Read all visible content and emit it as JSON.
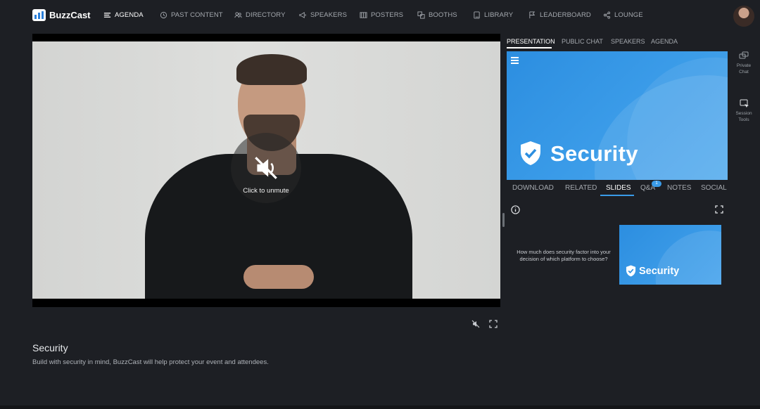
{
  "app": {
    "name": "BuzzCast"
  },
  "nav": {
    "items": [
      {
        "label": "AGENDA",
        "icon": "menu-lines-icon",
        "active": true
      },
      {
        "label": "PAST CONTENT",
        "icon": "history-icon"
      },
      {
        "label": "DIRECTORY",
        "icon": "people-icon"
      },
      {
        "label": "SPEAKERS",
        "icon": "megaphone-icon"
      },
      {
        "label": "POSTERS",
        "icon": "poster-icon"
      },
      {
        "label": "BOOTHS",
        "icon": "booths-icon"
      },
      {
        "label": "LIBRARY",
        "icon": "book-icon"
      },
      {
        "label": "LEADERBOARD",
        "icon": "leaderboard-icon"
      },
      {
        "label": "LOUNGE",
        "icon": "share-icon"
      }
    ]
  },
  "video": {
    "unmute_label": "Click to unmute",
    "muted": true
  },
  "session": {
    "title": "Security",
    "description": "Build with security in mind, BuzzCast will help protect your event and attendees."
  },
  "right_panel": {
    "tabs": [
      "PRESENTATION",
      "PUBLIC CHAT",
      "SPEAKERS",
      "AGENDA"
    ],
    "active_tab": "PRESENTATION",
    "slide_title": "Security",
    "sub_tabs": [
      "DOWNLOAD",
      "RELATED",
      "SLIDES",
      "Q&A",
      "NOTES",
      "SOCIAL"
    ],
    "active_sub_tab": "SLIDES",
    "qa_badge": "1",
    "slides": [
      {
        "question": "How much does security factor into your decision of which platform to choose?",
        "thumb_title": "Security"
      }
    ]
  },
  "rail": {
    "private_chat": "Private Chat",
    "session_tools": "Session Tools"
  },
  "colors": {
    "accent": "#3a9be8",
    "background": "#1d1f24",
    "slide_blue": "#2c8ee0"
  }
}
